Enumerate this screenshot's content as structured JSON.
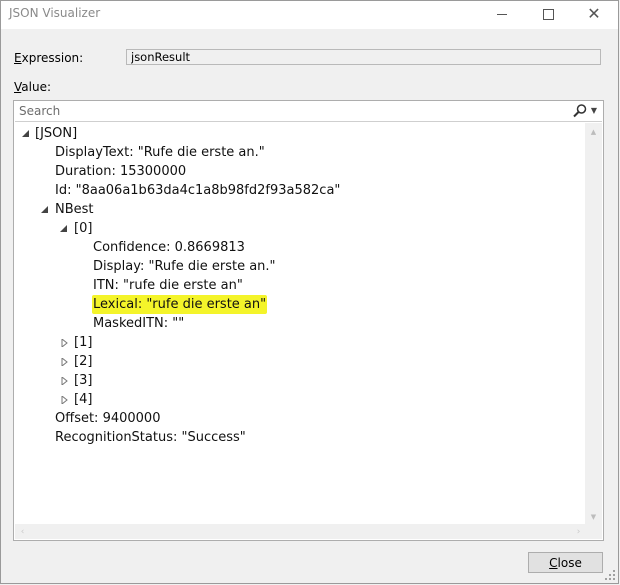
{
  "window": {
    "title": "JSON Visualizer"
  },
  "expression": {
    "label_mnemonic": "E",
    "label_rest": "xpression:",
    "value": "jsonResult"
  },
  "value_section": {
    "label_mnemonic": "V",
    "label_rest": "alue:"
  },
  "search": {
    "placeholder": "Search",
    "value": ""
  },
  "tree": {
    "root": "[JSON]",
    "display_text": "DisplayText: \"Rufe die erste an.\"",
    "duration": "Duration: 15300000",
    "id": "Id: \"8aa06a1b63da4c1a8b98fd2f93a582ca\"",
    "nbest": "NBest",
    "item0": "[0]",
    "confidence": "Confidence: 0.8669813",
    "display": "Display: \"Rufe die erste an.\"",
    "itn": "ITN: \"rufe die erste an\"",
    "lexical": "Lexical: \"rufe die erste an\"",
    "masked_itn": "MaskedITN: \"\"",
    "item1": "[1]",
    "item2": "[2]",
    "item3": "[3]",
    "item4": "[4]",
    "offset": "Offset: 9400000",
    "recognition_status": "RecognitionStatus: \"Success\""
  },
  "buttons": {
    "close_mnemonic": "C",
    "close_rest": "lose"
  },
  "colors": {
    "highlight": "#f4f42a",
    "title_text": "#8a8a8a"
  }
}
